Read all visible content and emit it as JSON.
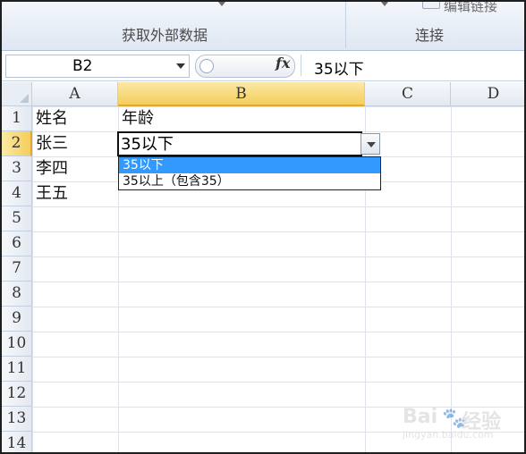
{
  "ribbon": {
    "groups": [
      {
        "label": "获取外部数据"
      },
      {
        "label": "连接"
      }
    ],
    "top_cut_text": "编辑链接"
  },
  "formula_bar": {
    "name_box": "B2",
    "fx_label": "fx",
    "content": "35以下"
  },
  "columns": [
    "A",
    "B",
    "C",
    "D"
  ],
  "rows": [
    "1",
    "2",
    "3",
    "4",
    "5",
    "6",
    "7",
    "8",
    "9",
    "10",
    "11",
    "12",
    "13",
    "14"
  ],
  "cells": {
    "A1": "姓名",
    "B1": "年龄",
    "A2": "张三",
    "A3": "李四",
    "A4": "王五"
  },
  "active_cell": {
    "ref": "B2",
    "value": "35以下"
  },
  "dropdown": {
    "options": [
      {
        "label": "35以下",
        "highlighted": true
      },
      {
        "label": "35以上（包含35）",
        "highlighted": false
      }
    ]
  },
  "watermark": {
    "brand_left": "Bai",
    "brand_right": "经验",
    "url": "jingyan.baidu.com"
  },
  "colors": {
    "selection_header": "#f5cd5a",
    "highlight": "#3399ff"
  }
}
